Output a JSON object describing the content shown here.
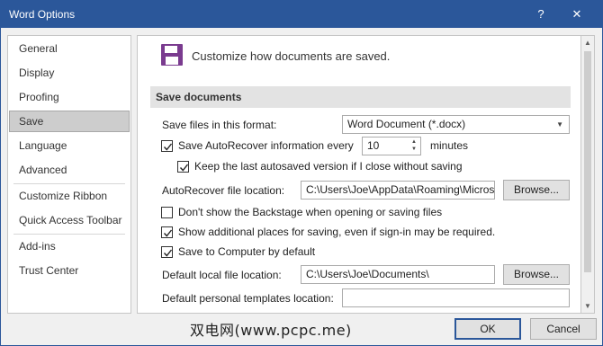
{
  "window": {
    "title": "Word Options",
    "help_glyph": "?",
    "close_glyph": "✕"
  },
  "nav": {
    "items": [
      {
        "label": "General"
      },
      {
        "label": "Display"
      },
      {
        "label": "Proofing"
      },
      {
        "label": "Save",
        "selected": true
      },
      {
        "label": "Language"
      },
      {
        "label": "Advanced"
      },
      {
        "label": "Customize Ribbon"
      },
      {
        "label": "Quick Access Toolbar"
      },
      {
        "label": "Add-ins"
      },
      {
        "label": "Trust Center"
      }
    ]
  },
  "header": {
    "icon": "floppy-disk-icon",
    "text": "Customize how documents are saved."
  },
  "section": {
    "title": "Save documents"
  },
  "settings": {
    "format_label": "Save files in this format:",
    "format_value": "Word Document (*.docx)",
    "autorecover_label": "Save AutoRecover information every",
    "autorecover_checked": true,
    "autorecover_minutes": "10",
    "minutes_label": "minutes",
    "keep_last_label": "Keep the last autosaved version if I close without saving",
    "keep_last_checked": true,
    "ar_location_label": "AutoRecover file location:",
    "ar_location_value": "C:\\Users\\Joe\\AppData\\Roaming\\Micros",
    "browse_label": "Browse...",
    "backstage_label": "Don't show the Backstage when opening or saving files",
    "backstage_checked": false,
    "additional_places_label": "Show additional places for saving, even if sign-in may be required.",
    "additional_places_checked": true,
    "save_to_computer_label": "Save to Computer by default",
    "save_to_computer_checked": true,
    "local_location_label": "Default local file location:",
    "local_location_value": "C:\\Users\\Joe\\Documents\\",
    "templates_label": "Default personal templates location:",
    "templates_value": ""
  },
  "footer": {
    "watermark": "双电网(www.pcpc.me)",
    "ok_label": "OK",
    "cancel_label": "Cancel"
  },
  "colors": {
    "titlebar": "#2b579a",
    "icon_purple": "#7a3b8f"
  }
}
